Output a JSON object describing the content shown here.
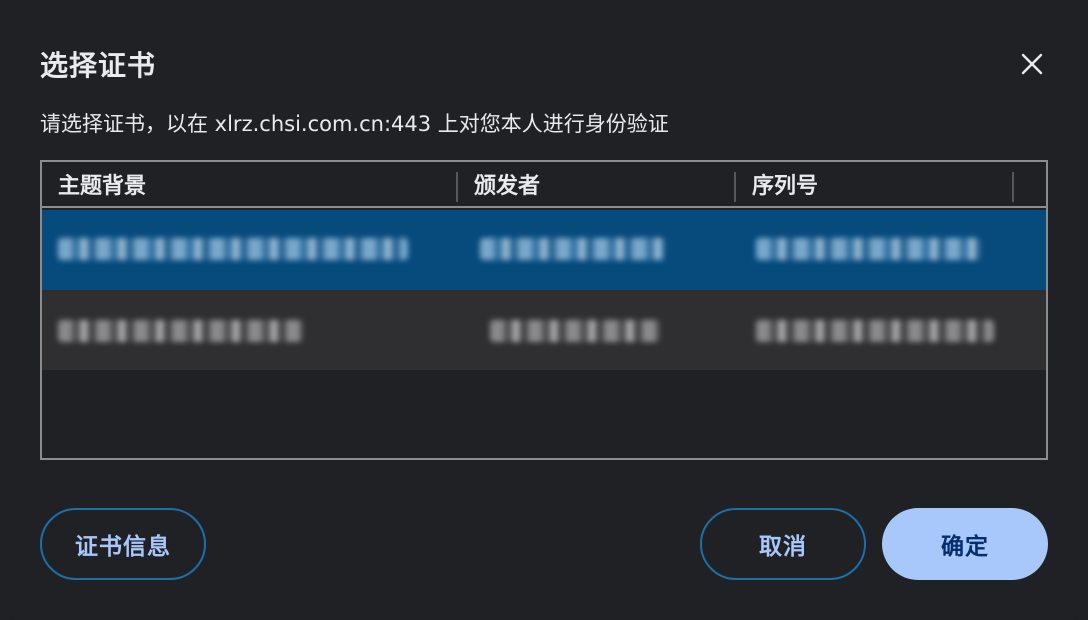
{
  "dialog": {
    "title": "选择证书",
    "subtitle": "请选择证书，以在 xlrz.chsi.com.cn:443 上对您本人进行身份验证",
    "close_icon": "close-icon"
  },
  "table": {
    "columns": [
      "主题背景",
      "颁发者",
      "序列号"
    ],
    "rows": [
      {
        "selected": true
      },
      {
        "selected": false
      }
    ]
  },
  "buttons": {
    "cert_info": "证书信息",
    "cancel": "取消",
    "confirm": "确定"
  },
  "colors": {
    "background": "#202124",
    "selected_row": "#064b7c",
    "accent": "#a8c7fa",
    "outline": "#1d6fa8"
  }
}
